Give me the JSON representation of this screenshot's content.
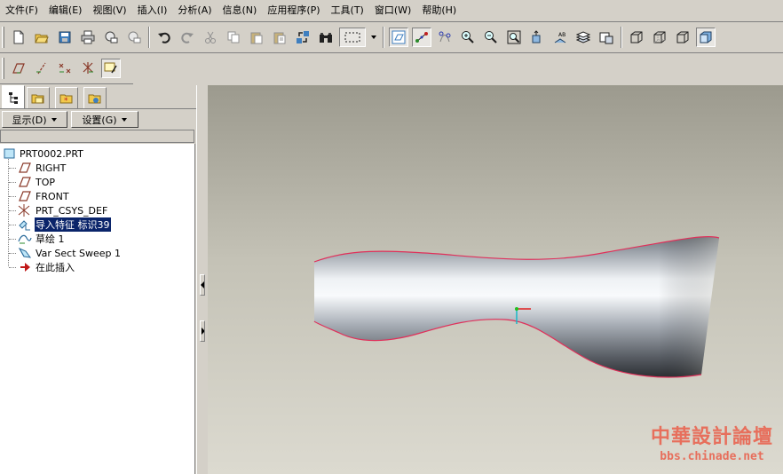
{
  "menu": [
    {
      "label": "文件(F)"
    },
    {
      "label": "编辑(E)"
    },
    {
      "label": "视图(V)"
    },
    {
      "label": "插入(I)"
    },
    {
      "label": "分析(A)"
    },
    {
      "label": "信息(N)"
    },
    {
      "label": "应用程序(P)"
    },
    {
      "label": "工具(T)"
    },
    {
      "label": "窗口(W)"
    },
    {
      "label": "帮助(H)"
    }
  ],
  "panel": {
    "show_label": "显示(D)",
    "settings_label": "设置(G)"
  },
  "tree": {
    "root": "PRT0002.PRT",
    "items": [
      {
        "label": "RIGHT",
        "icon": "datum-plane-icon"
      },
      {
        "label": "TOP",
        "icon": "datum-plane-icon"
      },
      {
        "label": "FRONT",
        "icon": "datum-plane-icon"
      },
      {
        "label": "PRT_CSYS_DEF",
        "icon": "csys-icon"
      },
      {
        "label": "导入特征 标识39",
        "icon": "import-feature-icon",
        "selected": true
      },
      {
        "label": "草绘 1",
        "icon": "sketch-icon"
      },
      {
        "label": "Var Sect Sweep 1",
        "icon": "sweep-icon"
      },
      {
        "label": "在此插入",
        "icon": "insert-here-arrow-icon"
      }
    ]
  },
  "watermark": {
    "text_cn": "中華設計論壇",
    "url": "bbs.chinade.net"
  },
  "colors": {
    "ui_face": "#d4d0c8",
    "selection": "#0a246a",
    "model_edge": "#e0305a",
    "watermark": "#e76f5c"
  }
}
